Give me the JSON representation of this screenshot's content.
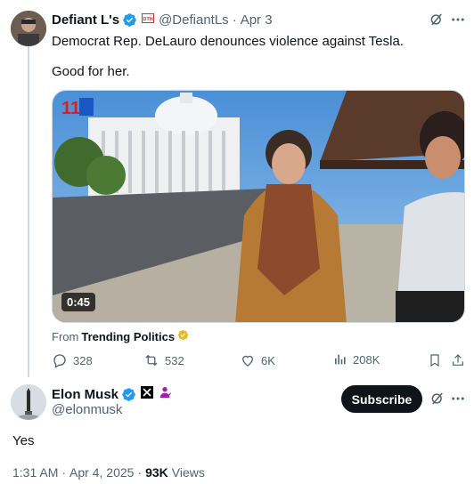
{
  "tweet1": {
    "display_name": "Defiant L's",
    "handle": "@DefiantLs",
    "separator": "·",
    "date": "Apr 3",
    "badge_icon": "verified-badge-icon",
    "mini_badge_text": "DTH",
    "text_line1": "Democrat Rep. DeLauro denounces violence against Tesla.",
    "text_line2": "Good for her.",
    "video": {
      "duration": "0:45",
      "channel_logo_text": "11"
    },
    "from_prefix": "From",
    "from_source": "Trending Politics",
    "actions": {
      "replies": "328",
      "reposts": "532",
      "likes": "6K",
      "views": "208K"
    }
  },
  "tweet2": {
    "display_name": "Elon Musk",
    "handle": "@elonmusk",
    "subscribe_label": "Subscribe",
    "text": "Yes",
    "time": "1:31 AM",
    "separator1": "·",
    "date": "Apr 4, 2025",
    "separator2": "·",
    "views_count": "93K",
    "views_label": "Views"
  },
  "colors": {
    "verified_blue": "#1d9bf0",
    "gold_badge": "#e8b829",
    "text_primary": "#0f1419",
    "text_muted": "#536471"
  }
}
